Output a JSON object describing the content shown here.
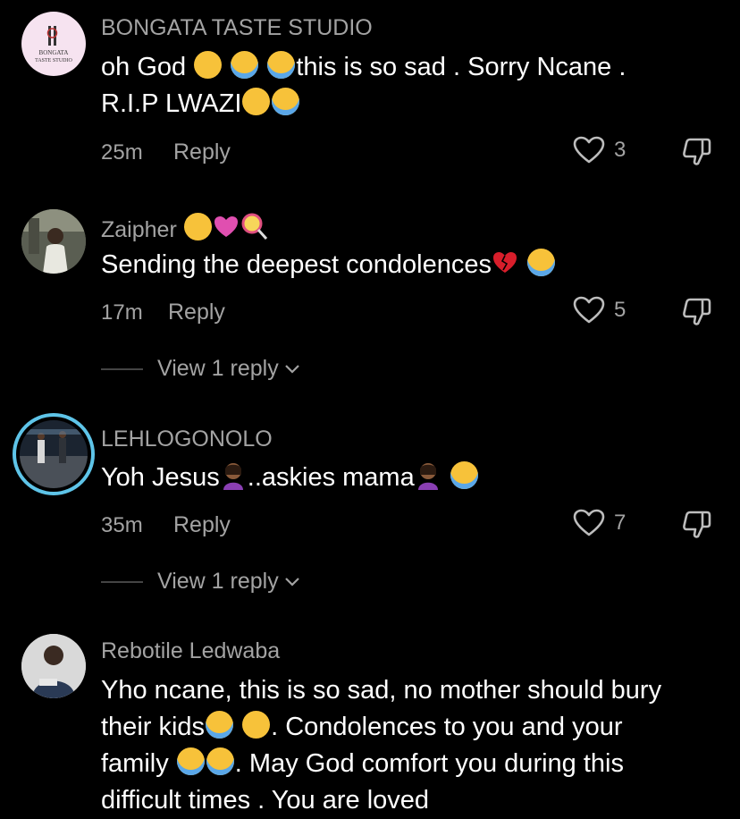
{
  "comments": [
    {
      "username": "BONGATA TASTE STUDIO",
      "avatar_text_1": "BONGATA",
      "avatar_text_2": "TASTE STUDIO",
      "text_1": "oh God ",
      "text_2": "this is so sad . Sorry Ncane .",
      "text_3": "R.I.P LWAZI",
      "time": "25m",
      "reply": "Reply",
      "likes": "3"
    },
    {
      "username": "Zaipher",
      "text_1": "Sending the deepest condolences",
      "time": "17m",
      "reply": "Reply",
      "likes": "5",
      "view_replies": "View 1 reply"
    },
    {
      "username": "LEHLOGONOLO",
      "text_1": "Yoh Jesus",
      "text_2": "..askies mama",
      "time": "35m",
      "reply": "Reply",
      "likes": "7",
      "view_replies": "View 1 reply"
    },
    {
      "username": "Rebotile Ledwaba",
      "line_1": "Yho ncane, this is so sad, no mother should bury",
      "line_2a": "their kids",
      "line_2b": ". Condolences to you and your",
      "line_3a": "family ",
      "line_3b": ". May God comfort you during this",
      "line_4": "difficult times . You are loved"
    }
  ],
  "colors": {
    "background": "#000000",
    "secondary_text": "#a3a3a3",
    "story_ring": "#5ec4e8"
  },
  "icons": [
    "heart-outline-icon",
    "dislike-icon",
    "chevron-down-icon"
  ]
}
